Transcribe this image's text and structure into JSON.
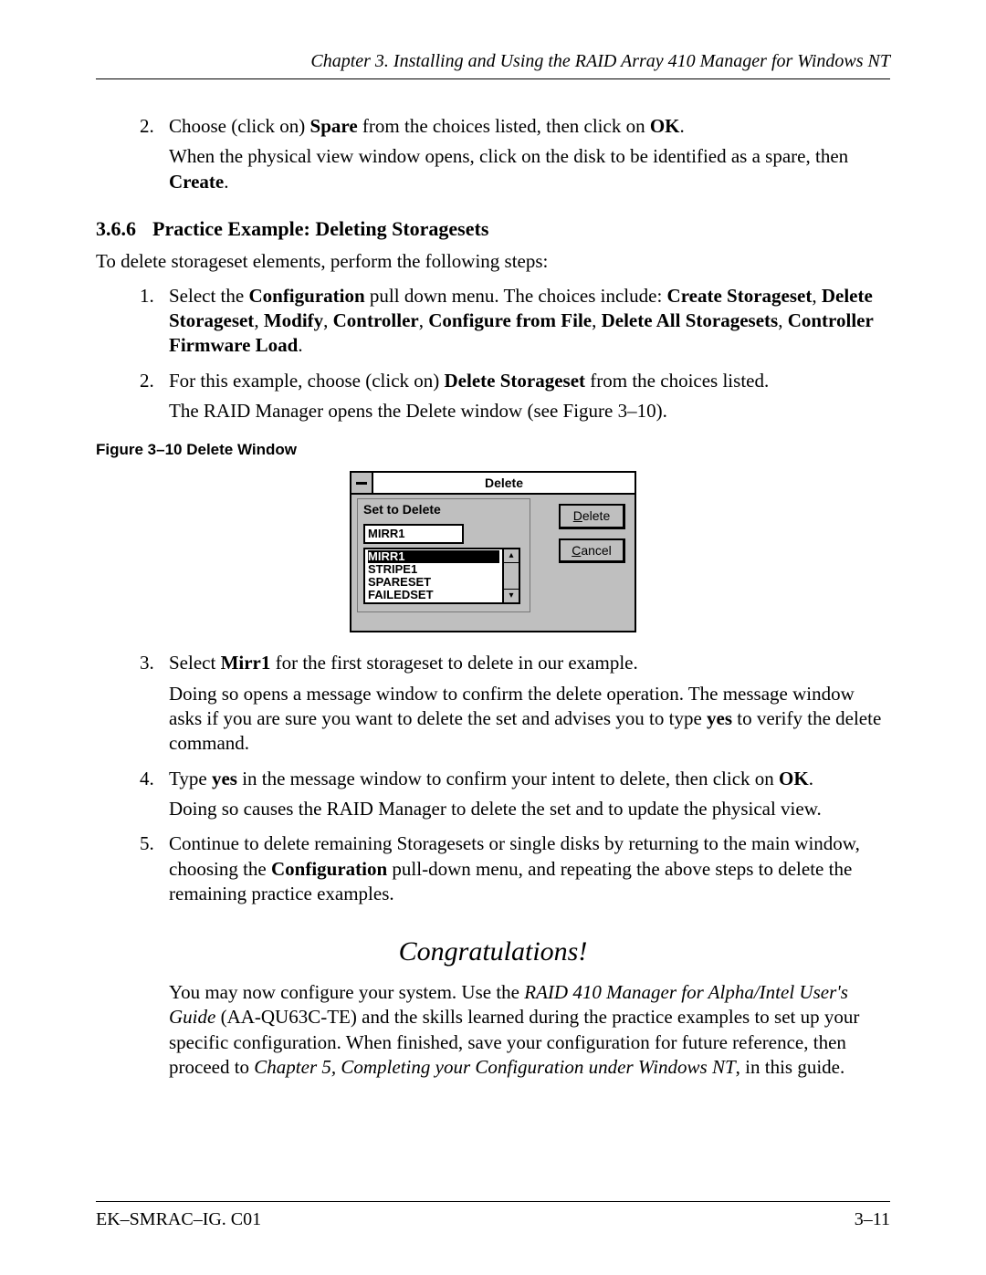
{
  "header": {
    "running": "Chapter 3.  Installing and Using the RAID Array 410 Manager for Windows NT"
  },
  "top_steps": {
    "item2_marker": "2.",
    "item2_a": "Choose (click on) ",
    "item2_b": "Spare",
    "item2_c": " from the choices listed, then click on ",
    "item2_d": "OK",
    "item2_e": ".",
    "item2_f": "When the physical view window opens, click on the disk to be identified as a spare, then ",
    "item2_g": "Create",
    "item2_h": "."
  },
  "section": {
    "number": "3.6.6",
    "title": "Practice Example: Deleting Storagesets",
    "intro": "To delete storageset elements, perform the following steps:"
  },
  "steps": {
    "s1_marker": "1.",
    "s1_a": "Select the ",
    "s1_b": "Configuration",
    "s1_c": " pull down menu. The choices include: ",
    "s1_d": "Create Storageset",
    "s1_e": ", ",
    "s1_f": "Delete Storageset",
    "s1_g": ", ",
    "s1_h": "Modify",
    "s1_i": ", ",
    "s1_j": "Controller",
    "s1_k": ", ",
    "s1_l": "Configure from File",
    "s1_m": ", ",
    "s1_n": "Delete All Storagesets",
    "s1_o": ", ",
    "s1_p": "Controller Firmware Load",
    "s1_q": ".",
    "s2_marker": "2.",
    "s2_a": "For this example, choose (click on) ",
    "s2_b": "Delete Storageset",
    "s2_c": " from the choices listed.",
    "s2_d": "The RAID Manager opens the Delete window (see Figure 3–10).",
    "s3_marker": "3.",
    "s3_a": "Select ",
    "s3_b": "Mirr1",
    "s3_c": " for the first storageset to delete in our example.",
    "s3_d_a": "Doing so opens a message window to confirm the delete operation. The message window asks if you are sure you want to delete the set and advises you to type ",
    "s3_d_b": "yes",
    "s3_d_c": " to verify the delete command.",
    "s4_marker": "4.",
    "s4_a": "Type ",
    "s4_b": "yes",
    "s4_c": " in the message window to confirm your intent to delete, then click on ",
    "s4_d": "OK",
    "s4_e": ".",
    "s4_f": "Doing so causes the RAID Manager to delete the set and to update the physical view.",
    "s5_marker": "5.",
    "s5_a": "Continue to delete remaining Storagesets or single disks by returning to the main window, choosing the ",
    "s5_b": "Configuration",
    "s5_c": " pull-down menu, and repeating the above steps to delete the remaining practice examples."
  },
  "figure": {
    "caption": "Figure 3–10  Delete Window",
    "title": "Delete",
    "group_label": "Set to Delete",
    "field_value": "MIRR1",
    "list": [
      "MIRR1",
      "STRIPE1",
      "SPARESET",
      "FAILEDSET"
    ],
    "btn_delete_ul": "D",
    "btn_delete_rest": "elete",
    "btn_cancel_ul": "C",
    "btn_cancel_rest": "ancel",
    "arrow_up": "▴",
    "arrow_dn": "▾"
  },
  "congrats": "Congratulations!",
  "outro": {
    "a": "You may now configure your system. Use the ",
    "b": "RAID 410 Manager for Alpha/Intel User's Guide",
    "c": " (AA-QU63C-TE) and the skills learned during the practice examples to set up your specific configuration. When finished, save your configuration for future reference, then proceed to ",
    "d": "Chapter 5, Completing your Configuration under Windows NT",
    "e": ", in this guide."
  },
  "footer": {
    "left": "EK–SMRAC–IG. C01",
    "right": "3–11"
  }
}
